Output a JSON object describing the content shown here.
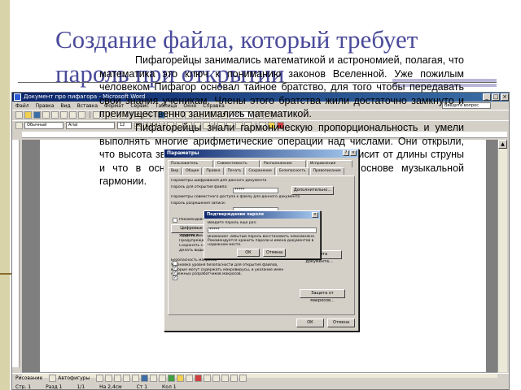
{
  "slide": {
    "title_line1": "Создание файла, который требует",
    "title_line2": "пароль при открытии"
  },
  "window": {
    "title": "Документ про пифагора - Microsoft Word",
    "help_placeholder": "Введите вопрос"
  },
  "menu": [
    "Файл",
    "Правка",
    "Вид",
    "Вставка",
    "Формат",
    "Сервис",
    "Таблица",
    "Окно",
    "Справка"
  ],
  "toolbar": {
    "zoom": "100%",
    "style": "Обычный",
    "font": "Arial",
    "size": "12",
    "bold": "Ж",
    "italic": "К",
    "underline": "Ч"
  },
  "document": {
    "paragraphs": [
      "Пифагорейцы занимались математикой и астрономией, полагая, что математика это ключ к пониманию законов Вселенной. Уже пожилым человеком Пифагор основал тайное братство, для того чтобы передавать свои знания ученикам. Члены этого братства жили достаточно замкнуто и преимущественно занимались математикой.",
      "Пифагорейцы знали гармоническую пропорциональность и умели выполнять многие арифметические операции над числами. Они открыли, что высота звука музыкального инструмента тона зависит от длины струны и что в основе этих чисел отношение лежит в основе музыкальной гармонии."
    ]
  },
  "options_dialog": {
    "title": "Параметры",
    "tabs_row1": [
      "Пользователь",
      "Совместимость",
      "Расположение",
      "Исправления"
    ],
    "tabs_row2": [
      "Вид",
      "Общие",
      "Правка",
      "Печать",
      "Сохранение",
      "Безопасность",
      "Правописание"
    ],
    "section1": "Параметры шифрования для данного документа",
    "password_open_label": "Пароль для открытия файла:",
    "password_open_value": "*****",
    "advanced_button": "Дополнительно...",
    "section2": "Параметры совместного доступа к файлу для данного документа",
    "password_modify_label": "Пароль разрешения записи:",
    "readonly_label": "Рекомендовать доступ только для чтения",
    "signature_button": "Цифровые подписи...",
    "protect_button": "Защита документа...",
    "section3": "Параметры конфиденциальности",
    "privacy_option1": "Удалить личные сведения из свойств файла при сохранении",
    "privacy_option2": "Предупреждать перед печатью, сохранением или отправкой файла",
    "privacy_option3": "Сохранять случайное число для улучшения точности объединения",
    "privacy_option4": "Делать видимой скрытую разметку при открытии или сохранении",
    "section4": "Безопасность макросов",
    "macro_text": "Установка уровня безопасности для открытия файлов, которые могут содержать макровирусы, и указание имен надежных разработчиков макросов.",
    "macro_button": "Защита от макросов...",
    "ok_button": "ОК",
    "cancel_button": "Отмена"
  },
  "confirm_dialog": {
    "title": "Подтверждение пароля",
    "label": "Введите пароль еще раз:",
    "value": "*****",
    "warning": "Внимание! Забытый пароль восстановить невозможно. Рекомендуется хранить пароли и имена документов в надежном месте.",
    "ok_button": "ОК",
    "cancel_button": "Отмена"
  },
  "drawbar": {
    "draw": "Рисование",
    "autoshapes": "Автофигуры"
  },
  "status": [
    "Стр. 1",
    "Разд 1",
    "1/1",
    "На 2,4см",
    "Ст 1",
    "Кол 1"
  ]
}
